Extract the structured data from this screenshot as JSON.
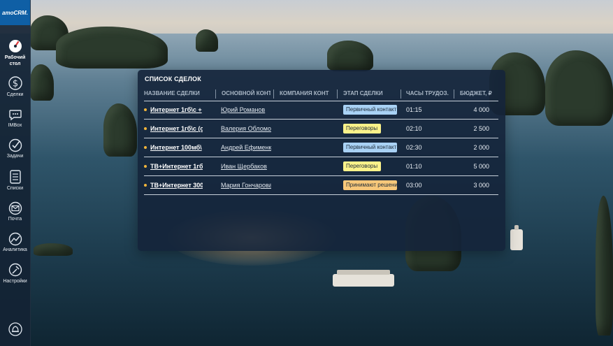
{
  "app": {
    "logo_text": "amoCRM."
  },
  "sidebar": {
    "items": [
      {
        "label": "Рабочий стол",
        "icon": "dashboard-icon",
        "active": true
      },
      {
        "label": "Сделки",
        "icon": "dollar-icon"
      },
      {
        "label": "IMBox",
        "icon": "chat-icon"
      },
      {
        "label": "Задачи",
        "icon": "check-icon"
      },
      {
        "label": "Списки",
        "icon": "list-icon"
      },
      {
        "label": "Почта",
        "icon": "mail-icon"
      },
      {
        "label": "Аналитика",
        "icon": "chart-icon"
      },
      {
        "label": "Настройки",
        "icon": "settings-icon"
      }
    ],
    "bottom_icon": "bell-icon"
  },
  "deals": {
    "title": "СПИСОК СДЕЛОК",
    "columns": [
      "НАЗВАНИЕ СДЕЛКИ",
      "ОСНОВНОЙ КОНТ",
      "КОМПАНИЯ КОНТ",
      "ЭТАП СДЕЛКИ",
      "ЧАСЫ ТРУДОЗ.",
      "БЮДЖЕТ, ₽"
    ],
    "rows": [
      {
        "name": "Интернет 1гб\\с +",
        "contact": "Юрий Романов",
        "company": "",
        "stage": "Первичный контакт",
        "stage_color": "#a9d2f5",
        "hours": "01:15",
        "budget": "4 000"
      },
      {
        "name": "Интернет 1гб\\с (с",
        "contact": "Валерия Обломова",
        "company": "",
        "stage": "Переговоры",
        "stage_color": "#fbf28a",
        "hours": "02:10",
        "budget": "2 500"
      },
      {
        "name": "Интернет 100мб\\",
        "contact": "Андрей Ефименко",
        "company": "",
        "stage": "Первичный контакт",
        "stage_color": "#a9d2f5",
        "hours": "02:30",
        "budget": "2 000"
      },
      {
        "name": "ТВ+Интернет 1гб",
        "contact": "Иван Щербаков",
        "company": "",
        "stage": "Переговоры",
        "stage_color": "#fbf28a",
        "hours": "01:10",
        "budget": "5 000"
      },
      {
        "name": "ТВ+Интернет 300",
        "contact": "Мария Гончарова",
        "company": "",
        "stage": "Принимают решение",
        "stage_color": "#f8c87a",
        "hours": "03:00",
        "budget": "3 000"
      }
    ],
    "row_dot_color": "#f2b53b"
  }
}
